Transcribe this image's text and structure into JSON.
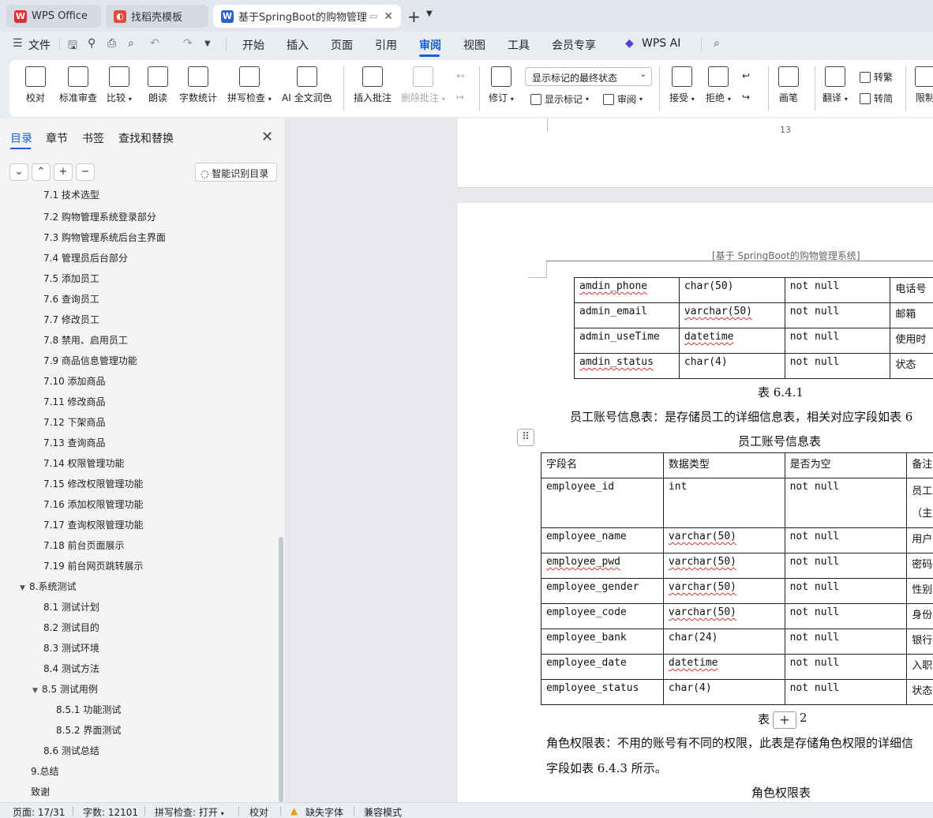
{
  "tabs": [
    {
      "label": "WPS Office",
      "icon": "wps-logo-icon"
    },
    {
      "label": "找稻壳模板",
      "icon": "docer-icon"
    },
    {
      "label": "基于SpringBoot的购物管理系统",
      "icon": "word-doc-icon"
    }
  ],
  "menu": {
    "file": "文件",
    "items": [
      "开始",
      "插入",
      "页面",
      "引用",
      "审阅",
      "视图",
      "工具",
      "会员专享",
      "WPS AI"
    ],
    "active": "审阅"
  },
  "ribbon": {
    "proofread": "校对",
    "standard_review": "标准审查",
    "compare": "比较",
    "read_aloud": "朗读",
    "word_count": "字数统计",
    "spell_check": "拼写检查",
    "ai_polish": "AI 全文润色",
    "insert_comment": "插入批注",
    "delete_comment": "删除批注",
    "track_changes": "修订",
    "markup_combo": "显示标记的最终状态",
    "show_markup": "显示标记",
    "review": "审阅",
    "accept": "接受",
    "reject": "拒绝",
    "pen": "画笔",
    "translate": "翻译",
    "to_traditional": "转繁",
    "to_simplified": "转简",
    "restrict": "限制"
  },
  "panel": {
    "tabs": [
      "目录",
      "章节",
      "书签",
      "查找和替换"
    ],
    "smart_toc": "智能识别目录",
    "toc": [
      {
        "label": "7.1 技术选型",
        "level": 2
      },
      {
        "label": "7.2 购物管理系统登录部分",
        "level": 2
      },
      {
        "label": "7.3 购物管理系统后台主界面",
        "level": 2
      },
      {
        "label": "7.4 管理员后台部分",
        "level": 2
      },
      {
        "label": "7.5 添加员工",
        "level": 2
      },
      {
        "label": "7.6 查询员工",
        "level": 2
      },
      {
        "label": "7.7 修改员工",
        "level": 2
      },
      {
        "label": "7.8 禁用、启用员工",
        "level": 2
      },
      {
        "label": "7.9 商品信息管理功能",
        "level": 2
      },
      {
        "label": "7.10 添加商品",
        "level": 2
      },
      {
        "label": "7.11 修改商品",
        "level": 2
      },
      {
        "label": "7.12 下架商品",
        "level": 2
      },
      {
        "label": "7.13 查询商品",
        "level": 2
      },
      {
        "label": "7.14 权限管理功能",
        "level": 2
      },
      {
        "label": "7.15 修改权限管理功能",
        "level": 2
      },
      {
        "label": "7.16 添加权限管理功能",
        "level": 2
      },
      {
        "label": "7.17 查询权限管理功能",
        "level": 2
      },
      {
        "label": "7.18 前台页面展示",
        "level": 2
      },
      {
        "label": "7.19 前台网页跳转展示",
        "level": 2
      },
      {
        "label": "8.系统测试",
        "level": 1,
        "expanded": true
      },
      {
        "label": "8.1 测试计划",
        "level": 2
      },
      {
        "label": "8.2 测试目的",
        "level": 2
      },
      {
        "label": "8.3 测试环境",
        "level": 2
      },
      {
        "label": "8.4 测试方法",
        "level": 2
      },
      {
        "label": "8.5 测试用例",
        "level": 2,
        "expanded": true
      },
      {
        "label": "8.5.1 功能测试",
        "level": 3
      },
      {
        "label": "8.5.2 界面测试",
        "level": 3
      },
      {
        "label": "8.6 测试总结",
        "level": 2
      },
      {
        "label": "9.总结",
        "level": 1
      },
      {
        "label": "致谢",
        "level": 1
      }
    ]
  },
  "doc": {
    "page_number": "13",
    "header": "[基于 SpringBoot的购物管理系统]",
    "table1_rows": [
      [
        "amdin_phone",
        "char(50)",
        "not null",
        "电话号"
      ],
      [
        "admin_email",
        "varchar(50)",
        "not null",
        "邮箱"
      ],
      [
        "admin_useTime",
        "datetime",
        "not null",
        "使用时"
      ],
      [
        "amdin_status",
        "char(4)",
        "not null",
        "状态"
      ]
    ],
    "caption1": "表 6.4.1",
    "para1": "员工账号信息表：是存储员工的详细信息表，相关对应字段如表 6",
    "table2_title": "员工账号信息表",
    "table2_header": [
      "字段名",
      "数据类型",
      "是否为空",
      "备注"
    ],
    "table2_rows": [
      [
        "employee_id",
        "int",
        "not null",
        "员工",
        "（主"
      ],
      [
        "employee_name",
        "varchar(50)",
        "not null",
        "用户"
      ],
      [
        "employee_pwd",
        "varchar(50)",
        "not null",
        "密码"
      ],
      [
        "employee_gender",
        "varchar(50)",
        "not null",
        "性别"
      ],
      [
        "employee_code",
        "varchar(50)",
        "not null",
        "身份"
      ],
      [
        "employee_bank",
        "char(24)",
        "not null",
        "银行"
      ],
      [
        "employee_date",
        "datetime",
        "not null",
        "入职"
      ],
      [
        "employee_status",
        "char(4)",
        "not null",
        "状态"
      ]
    ],
    "caption2_left": "表",
    "caption2_right": "2",
    "para2_line1": "角色权限表：不用的账号有不同的权限，此表是存储角色权限的详细信",
    "para2_line2": "字段如表 6.4.3 所示。",
    "table3_title": "角色权限表"
  },
  "status": {
    "page": "页面: 17/31",
    "words": "字数: 12101",
    "spell": "拼写检查: 打开",
    "proof": "校对",
    "missing_font": "缺失字体",
    "compat": "兼容模式"
  }
}
